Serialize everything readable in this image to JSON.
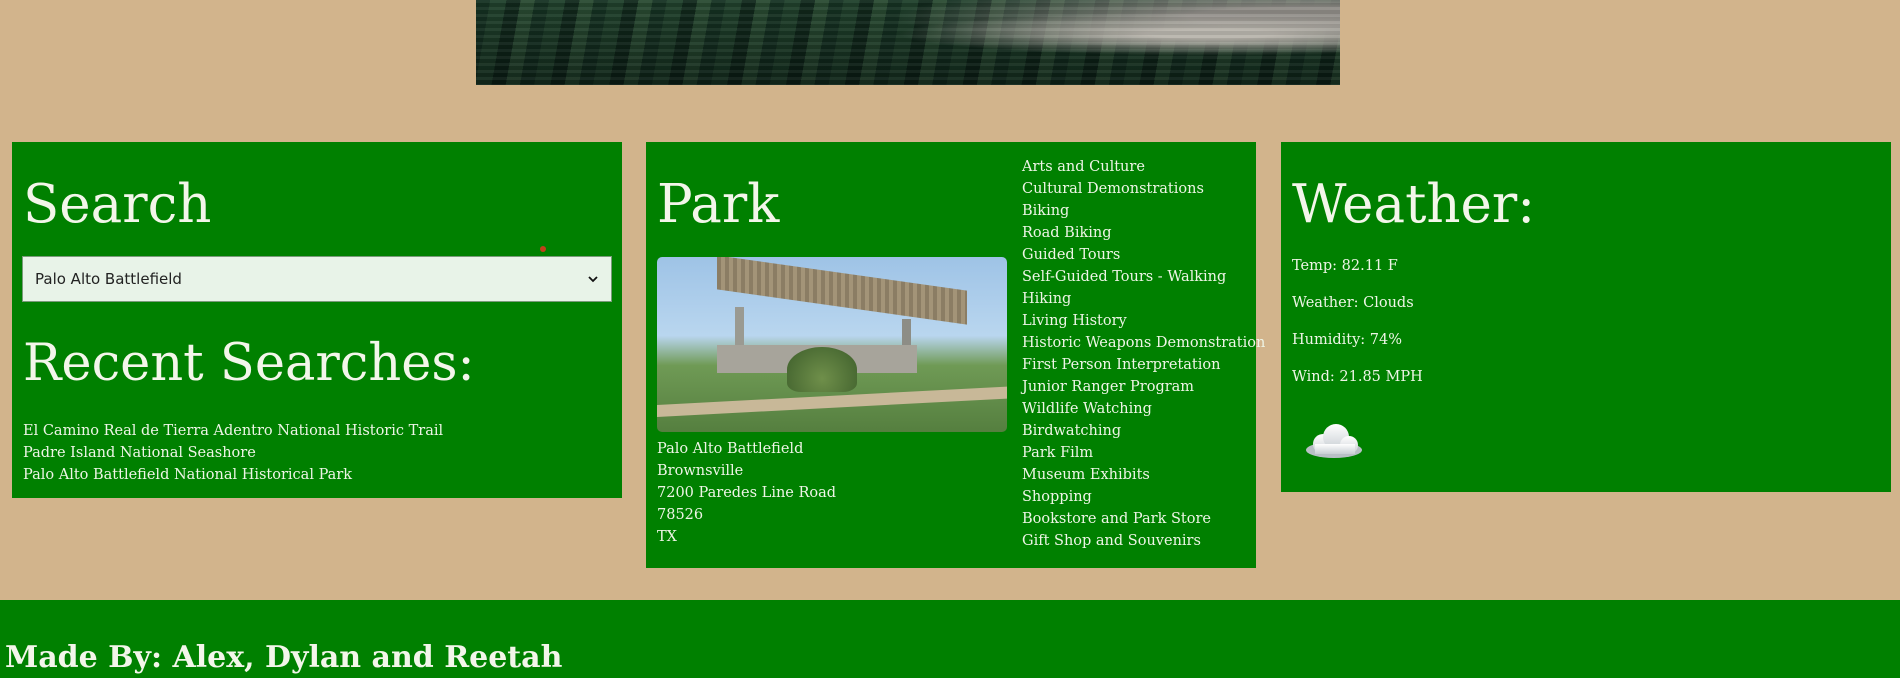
{
  "search": {
    "title": "Search",
    "selected_park": "Palo Alto Battlefield",
    "recent_title": "Recent Searches:",
    "recent": [
      "El Camino Real de Tierra Adentro National Historic Trail",
      "Padre Island National Seashore",
      "Palo Alto Battlefield National Historical Park"
    ]
  },
  "park": {
    "title": "Park",
    "name": "Palo Alto Battlefield",
    "city": "Brownsville",
    "street": "7200 Paredes Line Road",
    "zip": "78526",
    "state": "TX",
    "activities": [
      "Arts and Culture",
      "Cultural Demonstrations",
      "Biking",
      "Road Biking",
      "Guided Tours",
      "Self-Guided Tours - Walking",
      "Hiking",
      "Living History",
      "Historic Weapons Demonstration",
      "First Person Interpretation",
      "Junior Ranger Program",
      "Wildlife Watching",
      "Birdwatching",
      "Park Film",
      "Museum Exhibits",
      "Shopping",
      "Bookstore and Park Store",
      "Gift Shop and Souvenirs"
    ]
  },
  "weather": {
    "title": "Weather:",
    "temp": "Temp: 82.11 F",
    "condition": "Weather: Clouds",
    "humidity": "Humidity: 74%",
    "wind": "Wind: 21.85 MPH",
    "icon": "cloud-icon"
  },
  "footer": {
    "credits": "Made By: Alex, Dylan and Reetah"
  },
  "colors": {
    "page_background": "#d2b48c",
    "card_background": "#008000",
    "text": "#eef5e6"
  }
}
